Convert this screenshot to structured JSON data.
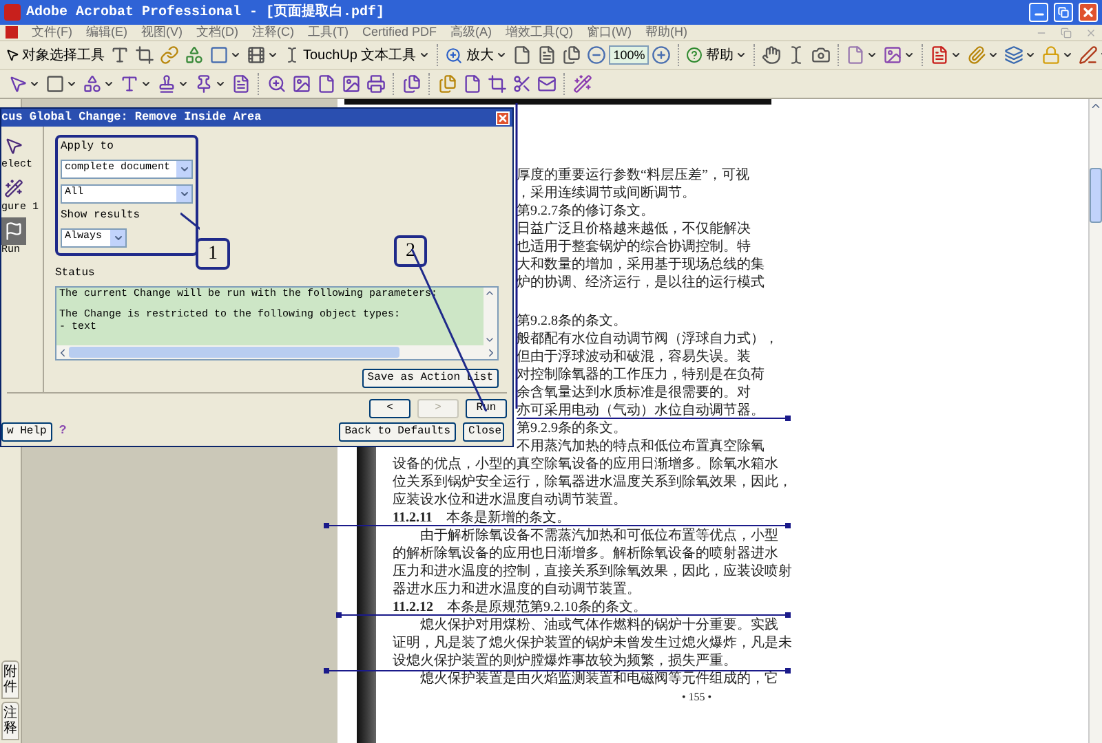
{
  "window": {
    "title": "Adobe Acrobat Professional - [页面提取白.pdf]"
  },
  "menu": [
    "文件(F)",
    "编辑(E)",
    "视图(V)",
    "文档(D)",
    "注释(C)",
    "工具(T)",
    "Certified PDF",
    "高级(A)",
    "增效工具(Q)",
    "窗口(W)",
    "帮助(H)"
  ],
  "toolbar": {
    "object_select": "对象选择工具",
    "touchup": "TouchUp 文本工具",
    "zoom_in": "放大",
    "zoom_level": "100%",
    "help": "帮助"
  },
  "nav_tabs": [
    "附件",
    "注释"
  ],
  "dialog": {
    "title": "cus Global Change: Remove Inside Area",
    "side_items": [
      {
        "label": "elect",
        "selected": false
      },
      {
        "label": "gure 1",
        "selected": false
      },
      {
        "label": "Run",
        "selected": true
      }
    ],
    "apply_to_label": "Apply to",
    "apply_to_value": "complete document",
    "object_filter_value": "All",
    "show_results_label": "Show results",
    "show_results_value": "Always",
    "status_label": "Status",
    "status_paragraphs": [
      [
        "The current Change will be run with the following parameters:"
      ],
      [
        "The Change is restricted to the following object types:",
        "- text"
      ]
    ],
    "save_button": "Save as Action List",
    "step_buttons": [
      {
        "label": "<",
        "disabled": false
      },
      {
        "label": ">",
        "disabled": true
      },
      {
        "label": "Run",
        "disabled": false
      }
    ],
    "help_button": "w Help",
    "help_icon": "?",
    "defaults_button": "Back to Defaults",
    "close_button": "Close",
    "callouts": [
      "1",
      "2"
    ]
  },
  "document": {
    "cut_paragraphs": [
      [
        "厚度的重要运行参数“料层压差”，可视",
        "，采用连续调节或间断调节。",
        "第9.2.7条的修订条文。",
        "日益广泛且价格越来越低，不仅能解决",
        "也适用于整套锅炉的综合协调控制。特",
        "大和数量的增加，采用基于现场总线的集",
        "炉的协调、经济运行，是以往的运行模式"
      ],
      [
        "第9.2.8条的条文。",
        "般都配有水位自动调节阀（浮球自力式），",
        "但由于浮球波动和破混，容易失误。装",
        "对控制除氧器的工作压力，特别是在负荷",
        "余含氧量达到水质标准是很需要的。对",
        "亦可采用电动（气动）水位自动调节器。",
        "第9.2.9条的条文。",
        "不用蒸汽加热的特点和低位布置真空除氧"
      ]
    ],
    "lines": [
      {
        "kind": "plain",
        "text": "设备的优点，小型的真空除氧设备的应用日渐增多。除氧水箱水"
      },
      {
        "kind": "plain",
        "text": "位关系到锅炉安全运行，除氧器进水温度关系到除氧效果，因此，"
      },
      {
        "kind": "plain",
        "text": "应装设水位和进水温度自动调节装置。"
      },
      {
        "kind": "plain",
        "text": "**11.2.11**　本条是新增的条文。"
      },
      {
        "kind": "indent",
        "text": "由于解析除氧设备不需蒸汽加热和可低位布置等优点，小型"
      },
      {
        "kind": "plain",
        "text": "的解析除氧设备的应用也日渐增多。解析除氧设备的喷射器进水"
      },
      {
        "kind": "plain",
        "text": "压力和进水温度的控制，直接关系到除氧效果，因此，应装设喷射"
      },
      {
        "kind": "plain",
        "text": "器进水压力和进水温度的自动调节装置。"
      },
      {
        "kind": "plain",
        "text": "**11.2.12**　本条是原规范第9.2.10条的条文。"
      },
      {
        "kind": "indent",
        "text": "熄火保护对用煤粉、油或气体作燃料的锅炉十分重要。实践"
      },
      {
        "kind": "plain",
        "text": "证明，凡是装了熄火保护装置的锅炉未曾发生过熄火爆炸，凡是未"
      },
      {
        "kind": "plain",
        "text": "设熄火保护装置的则炉膛爆炸事故较为频繁，损失严重。"
      },
      {
        "kind": "indent",
        "text": "熄火保护装置是由火焰监测装置和电磁阀等元件组成的，它"
      }
    ],
    "page_number": "• 155 •"
  }
}
